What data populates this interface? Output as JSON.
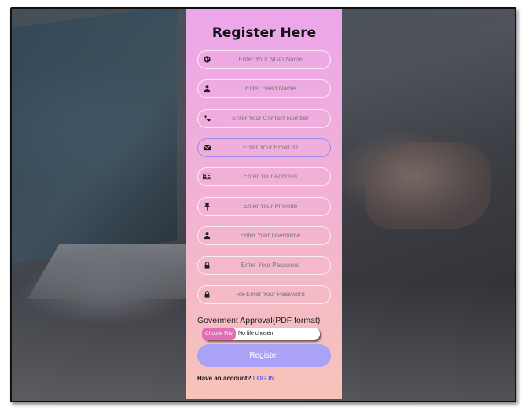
{
  "form": {
    "title": "Register Here",
    "fields": [
      {
        "placeholder": "Enter Your NGO Name",
        "icon": "globe-icon"
      },
      {
        "placeholder": "Enter Head Name",
        "icon": "user-icon"
      },
      {
        "placeholder": "Enter Your Contact Number",
        "icon": "phone-icon"
      },
      {
        "placeholder": "Enter Your Email ID",
        "icon": "envelope-icon"
      },
      {
        "placeholder": "Enter Your Address",
        "icon": "address-card-icon"
      },
      {
        "placeholder": "Enter Your Pincode",
        "icon": "pushpin-icon"
      },
      {
        "placeholder": "Enter Your Username",
        "icon": "user-icon"
      },
      {
        "placeholder": "Enter Your Password",
        "icon": "lock-icon"
      },
      {
        "placeholder": "Re-Enter Your Password",
        "icon": "lock-icon"
      }
    ],
    "approval_label": "Goverment Approval(PDF format)",
    "file_button": "Choose File",
    "file_status": "No file chosen",
    "submit_label": "Register",
    "login_prompt": "Have an account?",
    "login_link": "LOG IN"
  },
  "colors": {
    "panel_top": "#eca6ea",
    "panel_bottom": "#f7c4b8",
    "register_button": "#a9a2f6",
    "file_button": "#e46eb3",
    "focus_border": "#9a86f0",
    "link": "#6f5ff0"
  }
}
